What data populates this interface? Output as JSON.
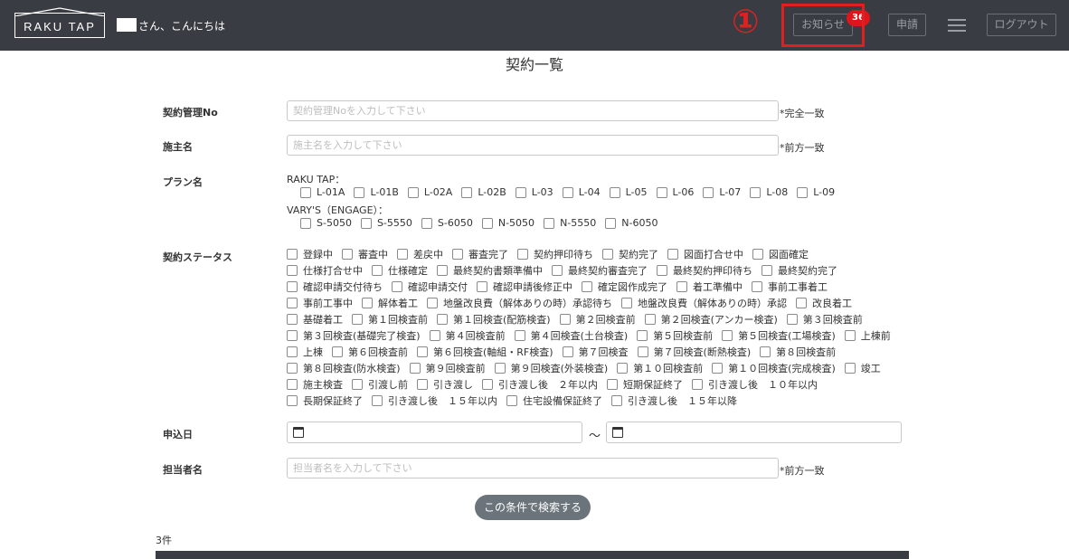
{
  "header": {
    "logo_text": "RAKU TAP",
    "greeting": "さん、こんにちは",
    "annotation_number": "①",
    "notice_label": "お知らせ",
    "notice_count": "36",
    "apply_label": "申請",
    "menu_icon": "hamburger-icon",
    "logout_label": "ログアウト",
    "bg_color": "#393c42",
    "annotation_color": "#e02020",
    "badge_color": "#e0151b"
  },
  "page": {
    "title": "契約一覧"
  },
  "form": {
    "contract_no": {
      "label": "契約管理No",
      "placeholder": "契約管理Noを入力して下さい",
      "value": "",
      "suffix": "*完全一致"
    },
    "owner_name": {
      "label": "施主名",
      "placeholder": "施主名を入力して下さい",
      "value": "",
      "suffix": "*前方一致"
    },
    "plan": {
      "label": "プラン名",
      "group1_title": "RAKU TAP：",
      "group1": [
        "L-01A",
        "L-01B",
        "L-02A",
        "L-02B",
        "L-03",
        "L-04",
        "L-05",
        "L-06",
        "L-07",
        "L-08",
        "L-09"
      ],
      "group2_title": "VARY'S（ENGAGE）：",
      "group2": [
        "S-5050",
        "S-5550",
        "S-6050",
        "N-5050",
        "N-5550",
        "N-6050"
      ]
    },
    "status": {
      "label": "契約ステータス",
      "rows": [
        [
          "登録中",
          "審査中",
          "差戻中",
          "審査完了",
          "契約押印待ち",
          "契約完了",
          "図面打合せ中",
          "図面確定"
        ],
        [
          "仕様打合せ中",
          "仕様確定",
          "最終契約書類準備中",
          "最終契約審査完了",
          "最終契約押印待ち",
          "最終契約完了"
        ],
        [
          "確認申請交付待ち",
          "確認申請交付",
          "確認申請後修正中",
          "確定図作成完了",
          "着工準備中",
          "事前工事着工"
        ],
        [
          "事前工事中",
          "解体着工",
          "地盤改良費（解体ありの時）承認待ち",
          "地盤改良費（解体ありの時）承認",
          "改良着工"
        ],
        [
          "基礎着工",
          "第１回検査前",
          "第１回検査(配筋検査)",
          "第２回検査前",
          "第２回検査(アンカー検査)",
          "第３回検査前"
        ],
        [
          "第３回検査(基礎完了検査)",
          "第４回検査前",
          "第４回検査(土台検査)",
          "第５回検査前",
          "第５回検査(工場検査)",
          "上棟前"
        ],
        [
          "上棟",
          "第６回検査前",
          "第６回検査(軸組・RF検査)",
          "第７回検査",
          "第７回検査(断熱検査)",
          "第８回検査前"
        ],
        [
          "第８回検査(防水検査)",
          "第９回検査前",
          "第９回検査(外装検査)",
          "第１０回検査前",
          "第１０回検査(完成検査)",
          "竣工"
        ],
        [
          "施主検査",
          "引渡し前",
          "引き渡し",
          "引き渡し後　２年以内",
          "短期保証終了",
          "引き渡し後　１０年以内"
        ],
        [
          "長期保証終了",
          "引き渡し後　１５年以内",
          "住宅設備保証終了",
          "引き渡し後　１５年以降"
        ]
      ]
    },
    "apply_date": {
      "label": "申込日",
      "separator": "～",
      "from": "",
      "to": ""
    },
    "staff_name": {
      "label": "担当者名",
      "placeholder": "担当者名を入力して下さい",
      "value": "",
      "suffix": "*前方一致"
    },
    "search_button": "この条件で検索する"
  },
  "results": {
    "count_text": "3件"
  }
}
